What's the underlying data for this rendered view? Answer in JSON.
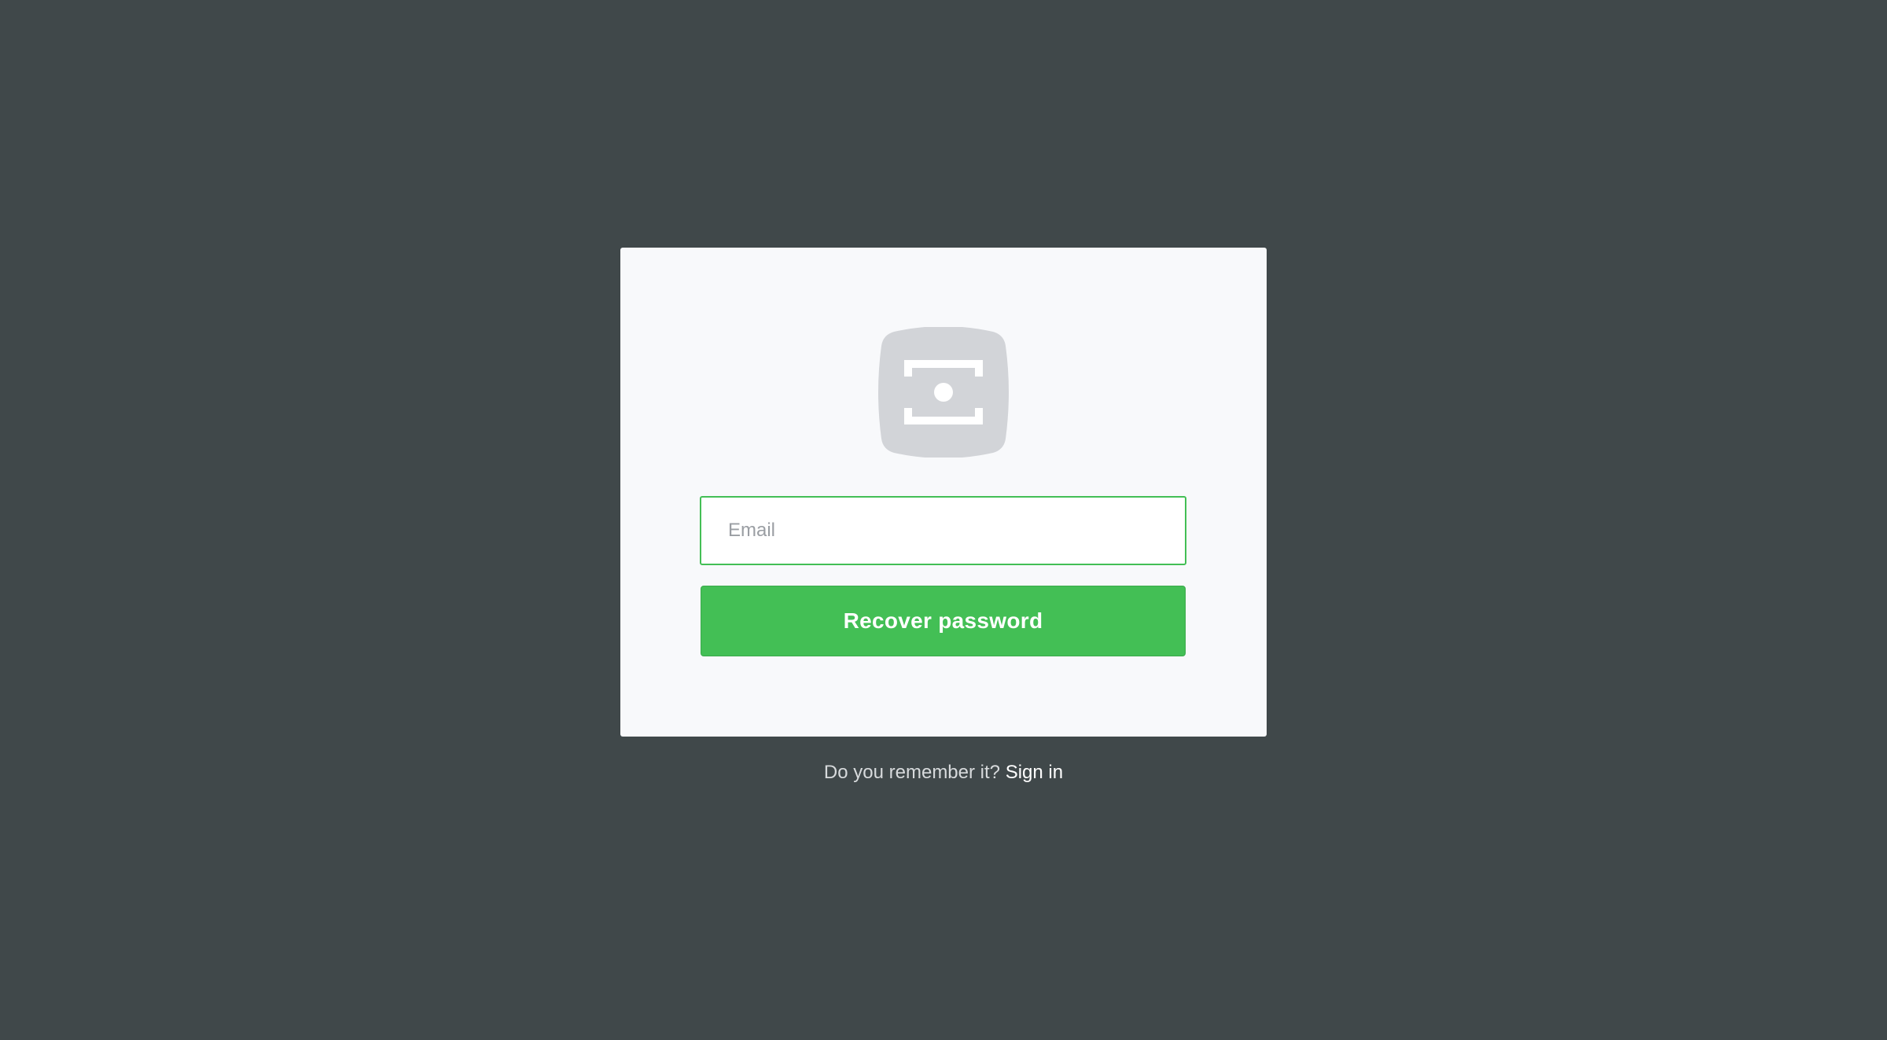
{
  "login_card": {
    "logo_icon": "money-bill-icon",
    "email_field": {
      "placeholder": "Email",
      "value": ""
    },
    "submit_label": "Recover password"
  },
  "footer": {
    "prompt_text": "Do you remember it?",
    "link_label": "Sign in"
  },
  "colors": {
    "background": "#40484a",
    "card": "#f8f9fb",
    "accent": "#43bf55",
    "logo": "#d2d4d8"
  }
}
